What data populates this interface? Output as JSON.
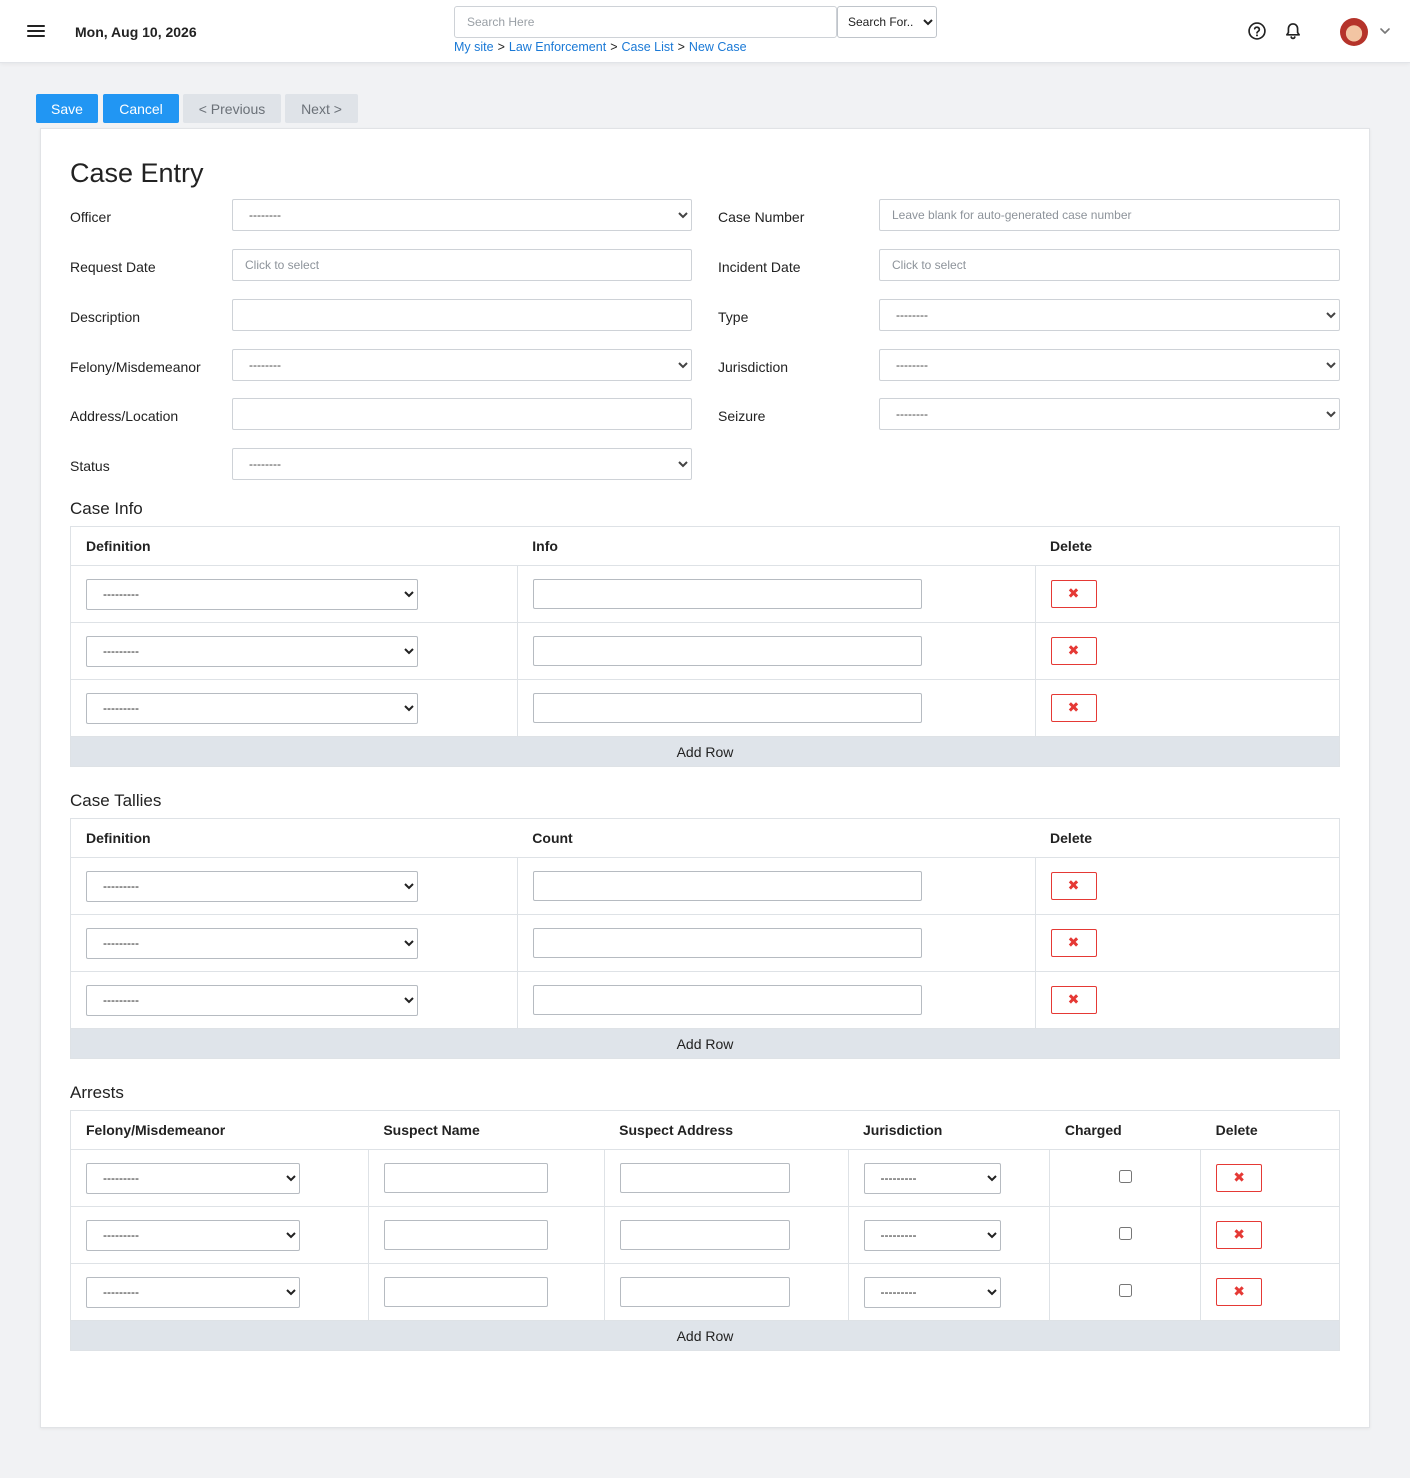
{
  "header": {
    "date": "Mon, Aug 10, 2026",
    "search_placeholder": "Search Here",
    "search_for": "Search For...",
    "breadcrumb": [
      "My site",
      "Law Enforcement",
      "Case List",
      "New Case"
    ],
    "breadcrumb_sep": ">"
  },
  "toolbar": {
    "save": "Save",
    "cancel": "Cancel",
    "previous": "< Previous",
    "next": "Next >"
  },
  "form": {
    "title": "Case Entry",
    "empty_option": "--------",
    "fields": {
      "officer": "Officer",
      "case_number": "Case Number",
      "case_number_placeholder": "Leave blank for auto-generated case number",
      "request_date": "Request Date",
      "request_date_placeholder": "Click to select",
      "incident_date": "Incident Date",
      "incident_date_placeholder": "Click to select",
      "description": "Description",
      "type": "Type",
      "felony_misdemeanor": "Felony/Misdemeanor",
      "jurisdiction": "Jurisdiction",
      "address_location": "Address/Location",
      "seizure": "Seizure",
      "status": "Status"
    }
  },
  "case_info": {
    "title": "Case Info",
    "headers": [
      "Definition",
      "Info",
      "Delete"
    ],
    "empty_option": "---------",
    "delete_symbol": "✖",
    "add_row": "Add Row"
  },
  "case_tallies": {
    "title": "Case Tallies",
    "headers": [
      "Definition",
      "Count",
      "Delete"
    ],
    "empty_option": "---------",
    "delete_symbol": "✖",
    "add_row": "Add Row"
  },
  "arrests": {
    "title": "Arrests",
    "headers": [
      "Felony/Misdemeanor",
      "Suspect Name",
      "Suspect Address",
      "Jurisdiction",
      "Charged",
      "Delete"
    ],
    "empty_option": "---------",
    "delete_symbol": "✖",
    "add_row": "Add Row"
  },
  "colors": {
    "primary": "#2196f3",
    "link": "#1a79d6",
    "danger": "#e53935",
    "add_row_bg": "#dfe4ea",
    "page_bg": "#f1f2f4"
  }
}
